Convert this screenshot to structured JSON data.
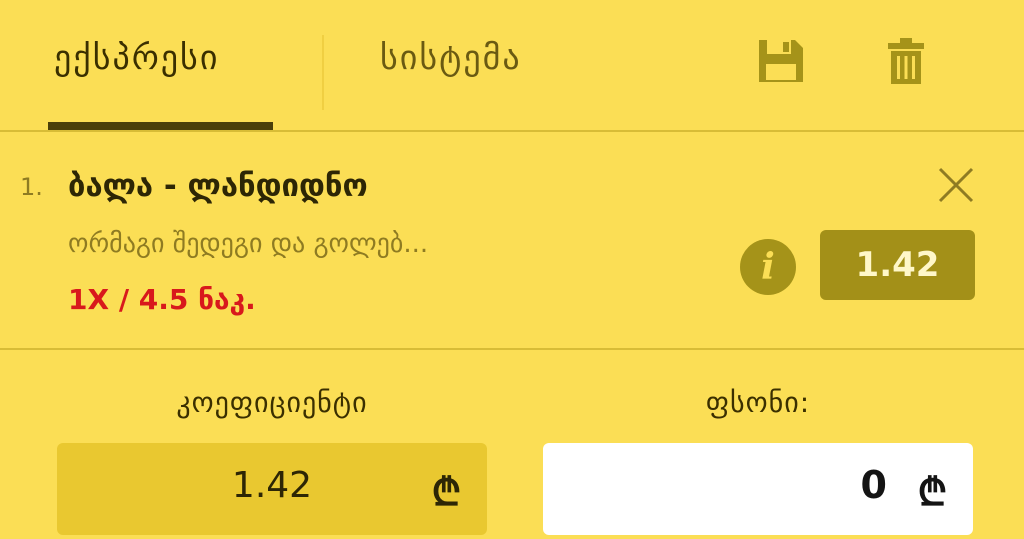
{
  "tabs": [
    {
      "label": "ექსპრესი",
      "active": true
    },
    {
      "label": "სისტემა",
      "active": false
    }
  ],
  "toolbar": {
    "icons": [
      "save-icon",
      "trash-icon"
    ]
  },
  "bet": {
    "number": "1.",
    "match": "ბალა - ლანდიდნო",
    "market": "ორმაგი შედეგი და გოლებ...",
    "pick": "1X / 4.5 ნაკ.",
    "odds": "1.42",
    "icons": [
      "close-icon",
      "info-icon"
    ]
  },
  "coefficient": {
    "label": "კოეფიციენტი",
    "value": "1.42",
    "currency": "₾"
  },
  "stake": {
    "label": "ფსონი:",
    "value": "0",
    "currency": "₾"
  },
  "colors": {
    "background": "#fbde55",
    "accent_dark": "#4a3f09",
    "odds_badge": "#a39018",
    "pick_red": "#d8191c",
    "coef_box": "#e9c830"
  }
}
